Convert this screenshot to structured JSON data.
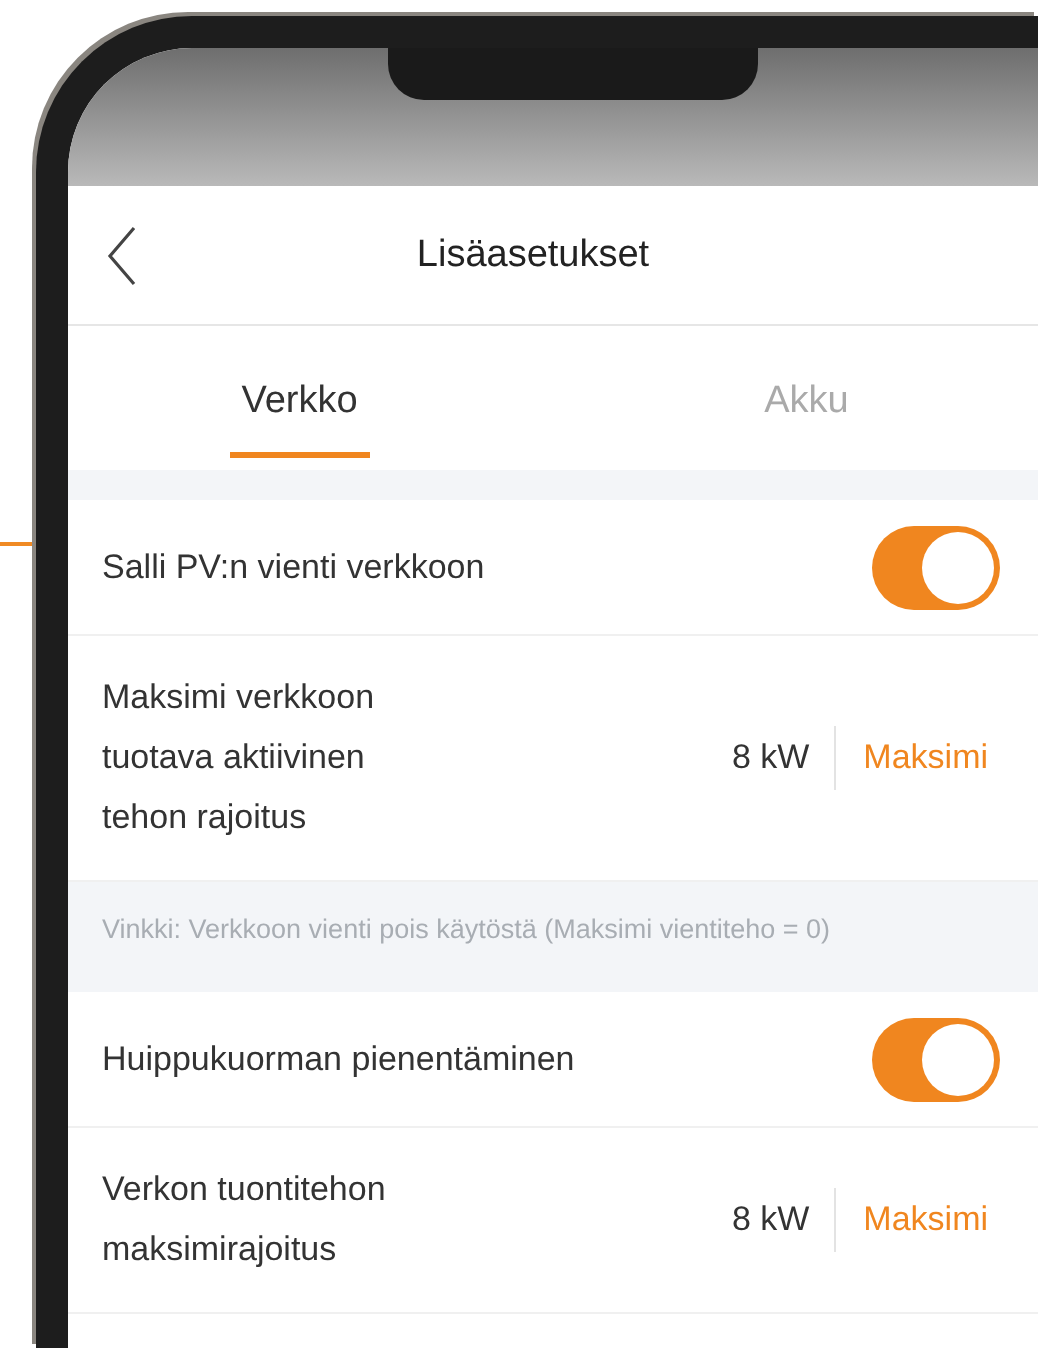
{
  "header": {
    "title": "Lisäasetukset"
  },
  "tabs": [
    {
      "label": "Verkko",
      "selected": true
    },
    {
      "label": "Akku",
      "selected": false
    }
  ],
  "settings": [
    {
      "kind": "toggle",
      "label": "Salli PV:n vienti verkkoon",
      "on": true
    },
    {
      "kind": "value",
      "label": "Maksimi verkkoon tuotava aktiivinen tehon rajoitus",
      "value": "8 kW",
      "action": "Maksimi"
    },
    {
      "kind": "tip",
      "text": "Vinkki: Verkkoon vienti pois käytöstä (Maksimi vientiteho = 0)"
    },
    {
      "kind": "toggle",
      "label": "Huippukuorman pienentäminen",
      "on": true
    },
    {
      "kind": "value",
      "label": "Verkon tuontitehon maksimirajoitus",
      "value": "8 kW",
      "action": "Maksimi"
    }
  ]
}
